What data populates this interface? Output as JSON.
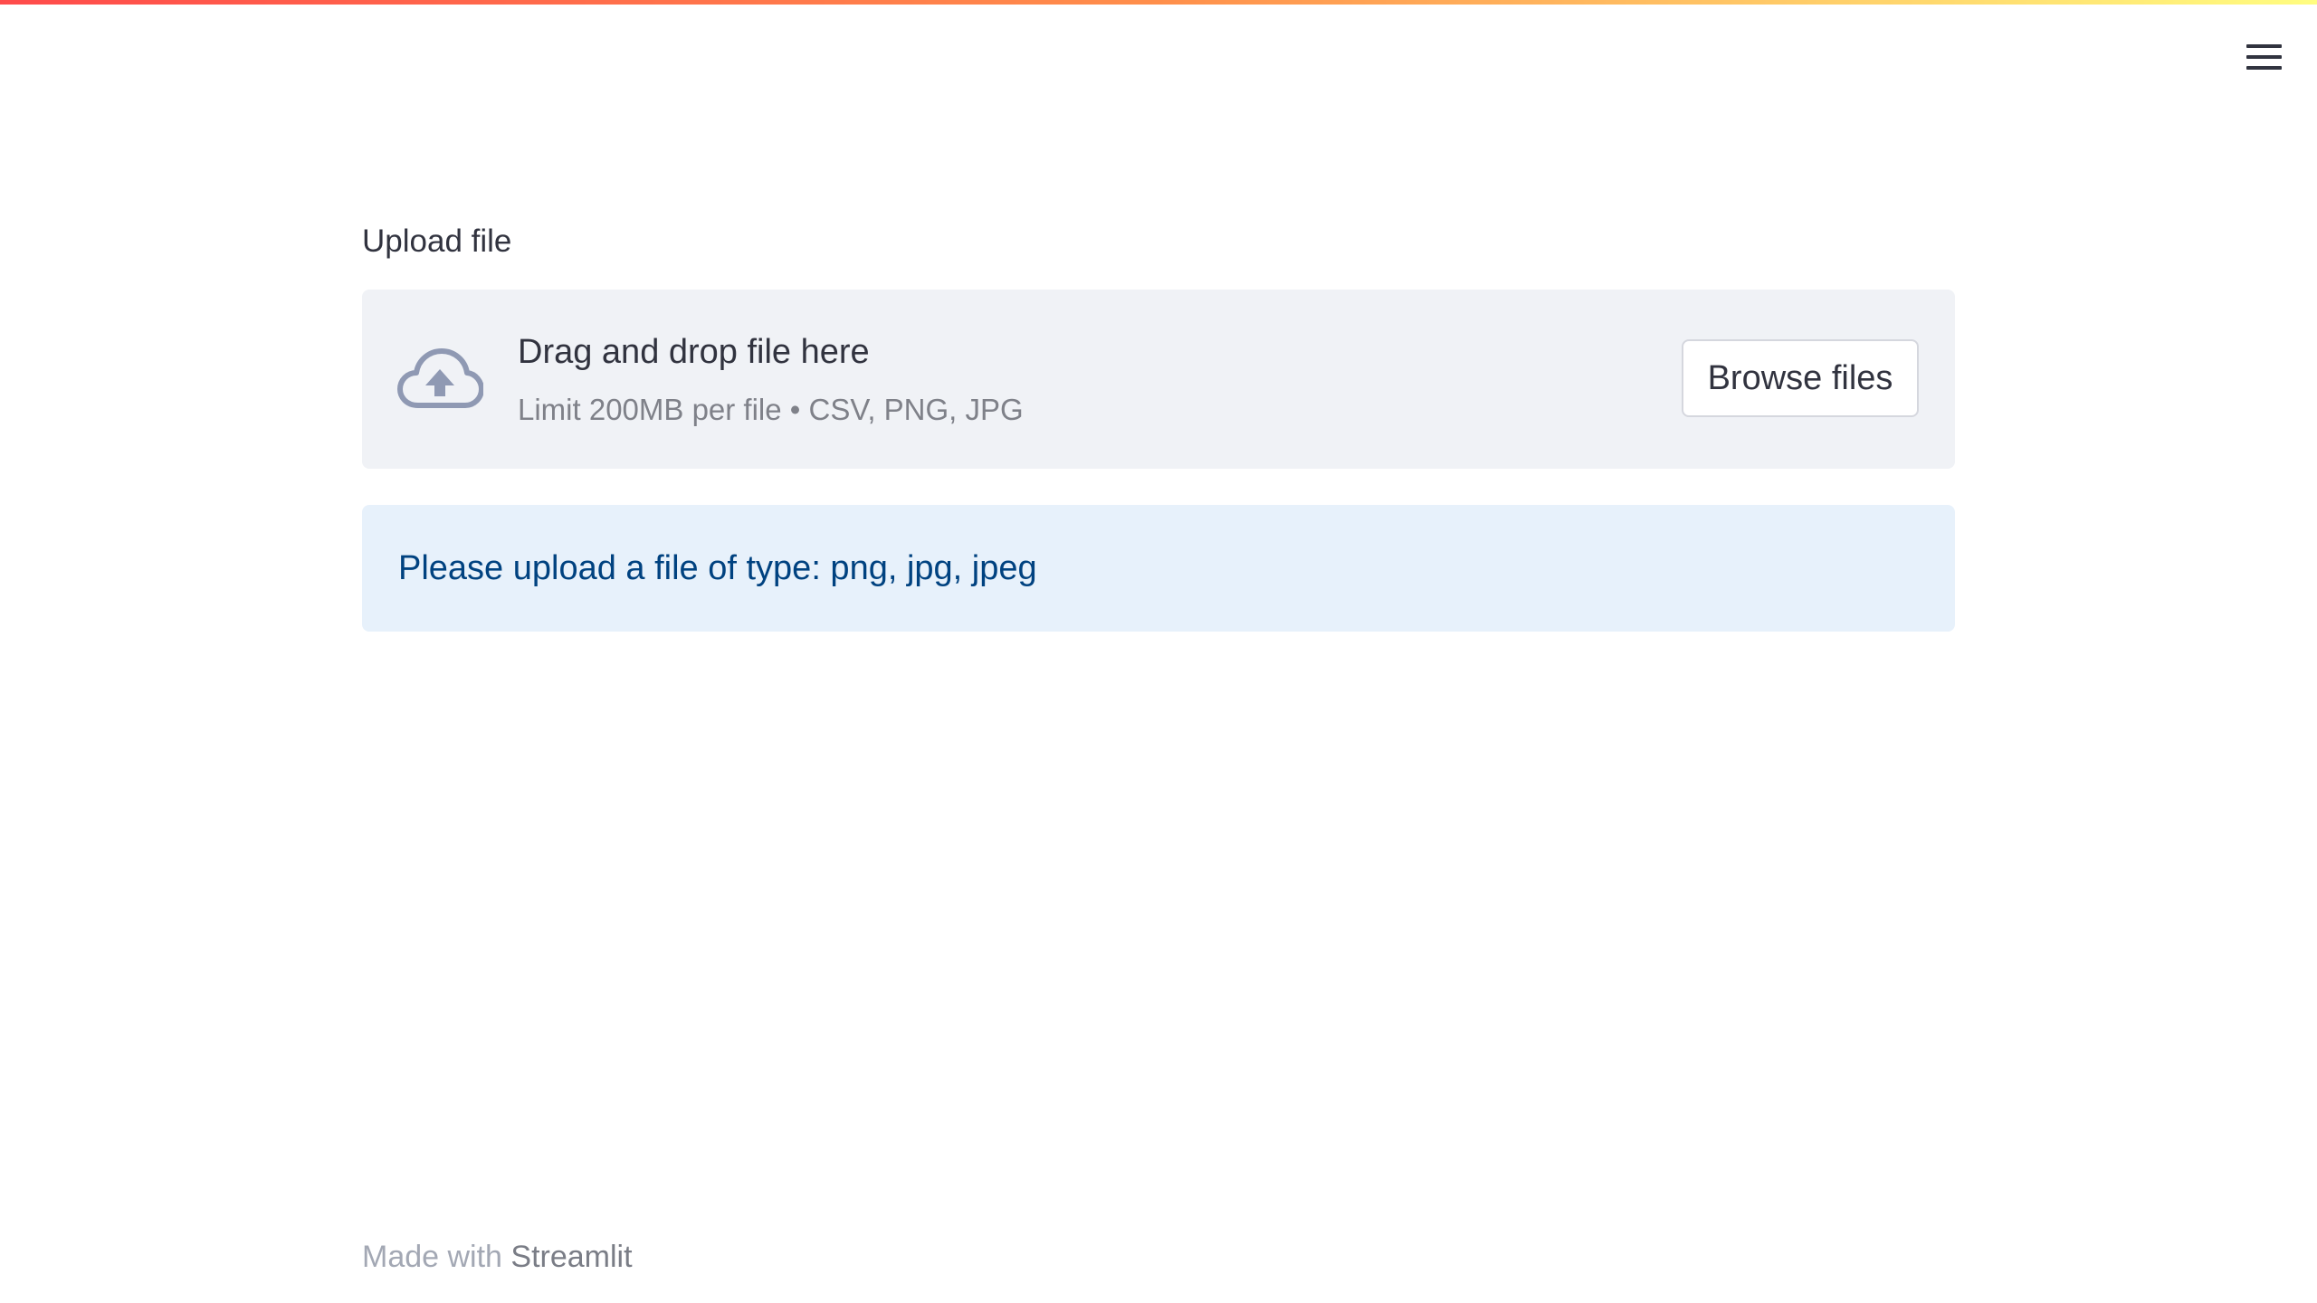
{
  "colors": {
    "top_gradient": [
      "#ff4b4b",
      "#ff8f4b",
      "#fffd80"
    ],
    "dropzone_bg": "#f0f2f6",
    "info_bg": "#e7f1fb",
    "info_text": "#004280",
    "icon": "#8f99b3"
  },
  "header": {
    "menu_icon": "hamburger-menu-icon"
  },
  "uploader": {
    "label": "Upload file",
    "dropzone": {
      "icon": "cloud-upload-icon",
      "title": "Drag and drop file here",
      "subtitle": "Limit 200MB per file • CSV, PNG, JPG",
      "browse_label": "Browse files"
    }
  },
  "info": {
    "message": "Please upload a file of type: png, jpg, jpeg"
  },
  "footer": {
    "prefix": "Made with ",
    "brand": "Streamlit"
  }
}
